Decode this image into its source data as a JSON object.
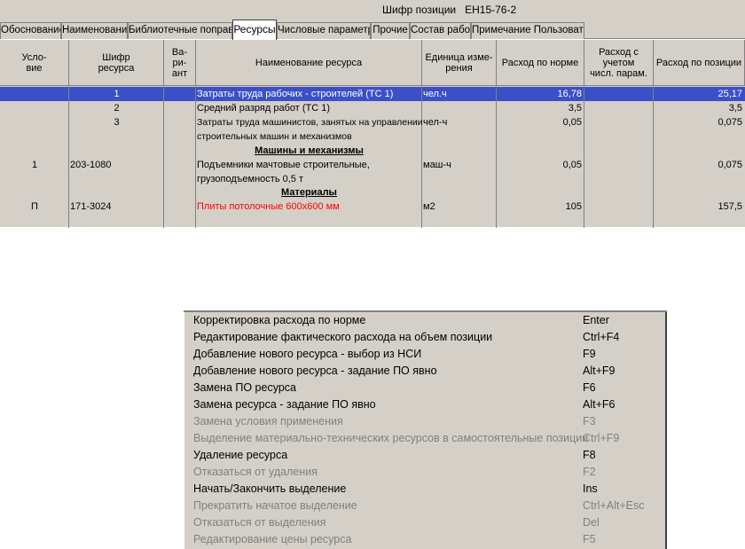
{
  "title": "Шифр позиции   ЕН15-76-2",
  "tabs": [
    {
      "label": "Обоснование"
    },
    {
      "label": "Наименование"
    },
    {
      "label": "Библиотечные поправки"
    },
    {
      "label": "Ресурсы"
    },
    {
      "label": "Числовые параметры"
    },
    {
      "label": "Прочие"
    },
    {
      "label": "Состав работ"
    },
    {
      "label": "Примечание Пользователя"
    }
  ],
  "columns": [
    {
      "label": "Усло-\nвие"
    },
    {
      "label": "Шифр\nресурса"
    },
    {
      "label": "Ва-\nри-\nант"
    },
    {
      "label": "Наименование ресурса"
    },
    {
      "label": "Единица изме-\nрения"
    },
    {
      "label": "Расход по норме"
    },
    {
      "label": "Расход с\nучетом\nчисл. парам."
    },
    {
      "label": "Расход по позиции"
    }
  ],
  "rows": {
    "r1": {
      "code": "1",
      "name": "Затраты труда рабочих - строителей (ТС 1)",
      "unit": "чел.ч",
      "norm": "16,78",
      "total": "25,17"
    },
    "r2": {
      "code": "2",
      "name": "Средний разряд работ (ТС 1)",
      "norm": "3,5",
      "total": "3,5"
    },
    "r3": {
      "code": "3",
      "name1": "Затраты труда машинистов, занятых на управлении",
      "name2": "строительных машин и механизмов",
      "unit": "чел-ч",
      "norm": "0,05",
      "total": "0,075"
    },
    "section1": "Машины и механизмы",
    "r4": {
      "cond": "1",
      "code": "203-1080",
      "name1": "Подъемники мачтовые строительные,",
      "name2": "грузоподъемность 0,5 т",
      "unit": "маш-ч",
      "norm": "0,05",
      "total": "0,075"
    },
    "section2": "Материалы",
    "r5": {
      "cond": "П",
      "code": "171-3024",
      "name": "Плиты потолочные 600х600 мм",
      "unit": "м2",
      "norm": "105",
      "total": "157,5"
    }
  },
  "menu": [
    {
      "label": "Корректировка расхода по норме",
      "key": "Enter",
      "enabled": true
    },
    {
      "label": "Редактирование фактического расхода  на объем позиции",
      "key": "Ctrl+F4",
      "enabled": true
    },
    {
      "label": "Добавление нового ресурса - выбор из НСИ",
      "key": "F9",
      "enabled": true
    },
    {
      "label": "Добавление нового ресурса - задание ПО явно",
      "key": "Alt+F9",
      "enabled": true
    },
    {
      "label": "Замена ПО ресурса",
      "key": "F6",
      "enabled": true
    },
    {
      "label": "Замена ресурса - задание ПО явно",
      "key": "Alt+F6",
      "enabled": true
    },
    {
      "label": "Замена условия применения",
      "key": "F3",
      "enabled": false
    },
    {
      "label": "Выделение материально-технических ресурсов в самостоятельные позиции",
      "key": "Ctrl+F9",
      "enabled": false
    },
    {
      "label": "Удаление ресурса",
      "key": "F8",
      "enabled": true
    },
    {
      "label": "Отказаться от удаления",
      "key": "F2",
      "enabled": false
    },
    {
      "label": "Начать/Закончить выделение",
      "key": "Ins",
      "enabled": true
    },
    {
      "label": "Прекратить начатое выделение",
      "key": "Ctrl+Alt+Esc",
      "enabled": false
    },
    {
      "label": "Отказаться от выделения",
      "key": "Del",
      "enabled": false
    },
    {
      "label": "Редактирование цены ресурса",
      "key": "F5",
      "enabled": false
    }
  ]
}
